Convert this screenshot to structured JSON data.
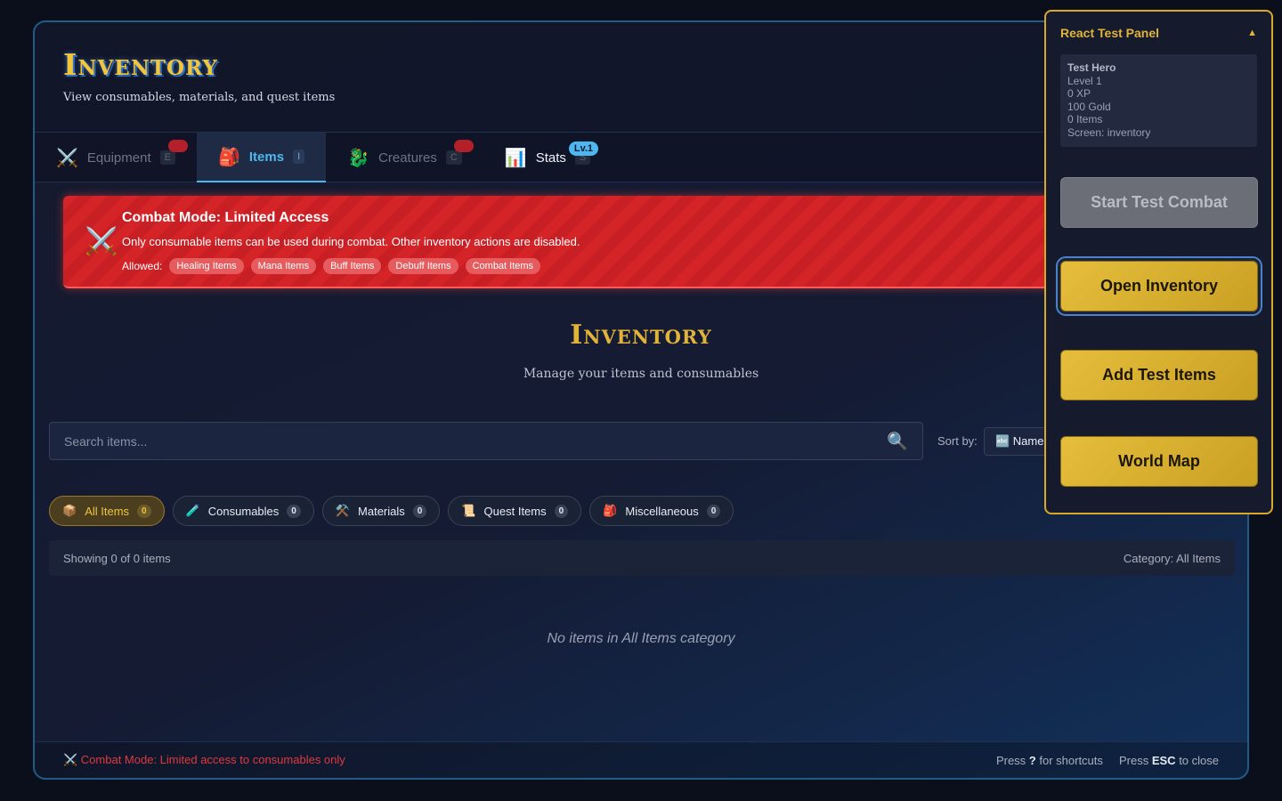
{
  "header": {
    "title": "Inventory",
    "subtitle": "View consumables, materials, and quest items"
  },
  "tabs": [
    {
      "icon": "⚔️",
      "label": "Equipment",
      "key": "E"
    },
    {
      "icon": "🎒",
      "label": "Items",
      "key": "I"
    },
    {
      "icon": "🐉",
      "label": "Creatures",
      "key": "C"
    },
    {
      "icon": "📊",
      "label": "Stats",
      "key": "S",
      "badge": "Lv.1"
    }
  ],
  "combat_banner": {
    "icon": "⚔️",
    "title": "Combat Mode: Limited Access",
    "description": "Only consumable items can be used during combat. Other inventory actions are disabled.",
    "allowed_label": "Allowed:",
    "allowed": [
      "Healing Items",
      "Mana Items",
      "Buff Items",
      "Debuff Items",
      "Combat Items"
    ]
  },
  "inventory": {
    "title": "Inventory",
    "subtitle": "Manage your items and consumables"
  },
  "search": {
    "placeholder": "Search items...",
    "value": ""
  },
  "sort": {
    "label": "Sort by:",
    "selected": "🔤 Name"
  },
  "categories": [
    {
      "icon": "📦",
      "label": "All Items",
      "count": "0"
    },
    {
      "icon": "🧪",
      "label": "Consumables",
      "count": "0"
    },
    {
      "icon": "⚒️",
      "label": "Materials",
      "count": "0"
    },
    {
      "icon": "📜",
      "label": "Quest Items",
      "count": "0"
    },
    {
      "icon": "🎒",
      "label": "Miscellaneous",
      "count": "0"
    }
  ],
  "status": {
    "showing": "Showing 0 of 0 items",
    "category": "Category: All Items"
  },
  "empty_message": "No items in All Items category",
  "footer": {
    "combat_note": "⚔️ Combat Mode: Limited access to consumables only",
    "shortcut_pre": "Press",
    "shortcut_key": "?",
    "shortcut_post": "for shortcuts",
    "close_pre": "Press",
    "close_key": "ESC",
    "close_post": "to close"
  },
  "test_panel": {
    "title": "React Test Panel",
    "toggle": "▲",
    "info": {
      "name": "Test Hero",
      "level": "Level 1",
      "xp": "0 XP",
      "gold": "100 Gold",
      "items": "0 Items",
      "screen": "Screen: inventory"
    },
    "buttons": [
      "Start Test Combat",
      "Open Inventory",
      "Add Test Items",
      "World Map"
    ]
  },
  "colors": {
    "accent_gold": "#f2c63c",
    "accent_blue": "#4fb7f0",
    "danger_red": "#d42428"
  }
}
